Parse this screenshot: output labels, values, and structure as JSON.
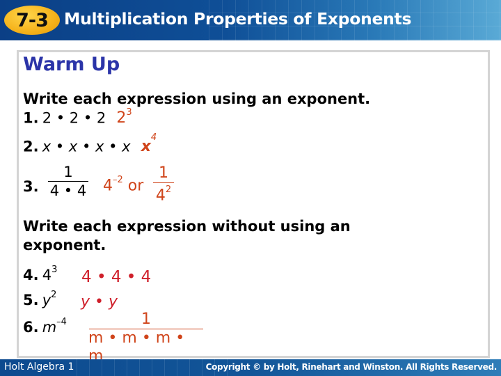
{
  "header": {
    "lesson_number": "7-3",
    "title": "Multiplication Properties of Exponents"
  },
  "section_title": "Warm Up",
  "part1": {
    "instruction": "Write each expression using an exponent.",
    "items": [
      {
        "number": "1.",
        "expression": "2 • 2 • 2",
        "answer_base": "2",
        "answer_exp": "3"
      },
      {
        "number": "2.",
        "expression": "x • x • x • x",
        "answer_base": "x",
        "answer_exp": "4"
      },
      {
        "number": "3.",
        "expression_numerator": "1",
        "expression_denominator": "4 • 4",
        "answer_base": "4",
        "answer_exp": "–2",
        "answer_or": "or",
        "answer_frac_numerator": "1",
        "answer_frac_den_base": "4",
        "answer_frac_den_exp": "2"
      }
    ]
  },
  "part2": {
    "instruction_line1": "Write each expression without using an",
    "instruction_line2": "exponent.",
    "items": [
      {
        "number": "4.",
        "expression_base": "4",
        "expression_exp": "3",
        "answer": "4 • 4 • 4"
      },
      {
        "number": "5.",
        "expression_base": "y",
        "expression_exp": "2",
        "answer": "y • y"
      },
      {
        "number": "6.",
        "expression_base": "m",
        "expression_exp": "–4",
        "answer_numerator": "1",
        "answer_denominator": "m • m • m • m"
      }
    ]
  },
  "footer": {
    "left": "Holt Algebra 1",
    "right": "Copyright © by Holt, Rinehart and Winston. All Rights Reserved."
  },
  "colors": {
    "header_blue": "#0f4f97",
    "badge_gold": "#f5b21a",
    "section_title": "#2b34a8",
    "answer_orange": "#d0451b",
    "answer_red": "#cf1f2a"
  }
}
